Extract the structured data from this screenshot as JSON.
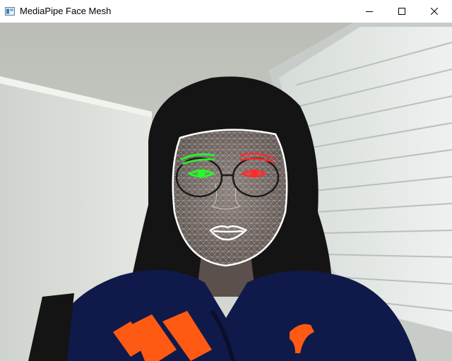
{
  "window": {
    "title": "MediaPipe Face Mesh",
    "icons": {
      "app": "opencv-window-icon",
      "minimize": "minimize-icon",
      "maximize": "maximize-icon",
      "close": "close-icon"
    }
  },
  "colors": {
    "contour": "#ffffff",
    "tessellation": "#c0c0c0",
    "left_eye": "#22ff22",
    "right_eye": "#ff2b2b",
    "jacket": "#0f1a4a",
    "logo": "#ff5a14"
  }
}
